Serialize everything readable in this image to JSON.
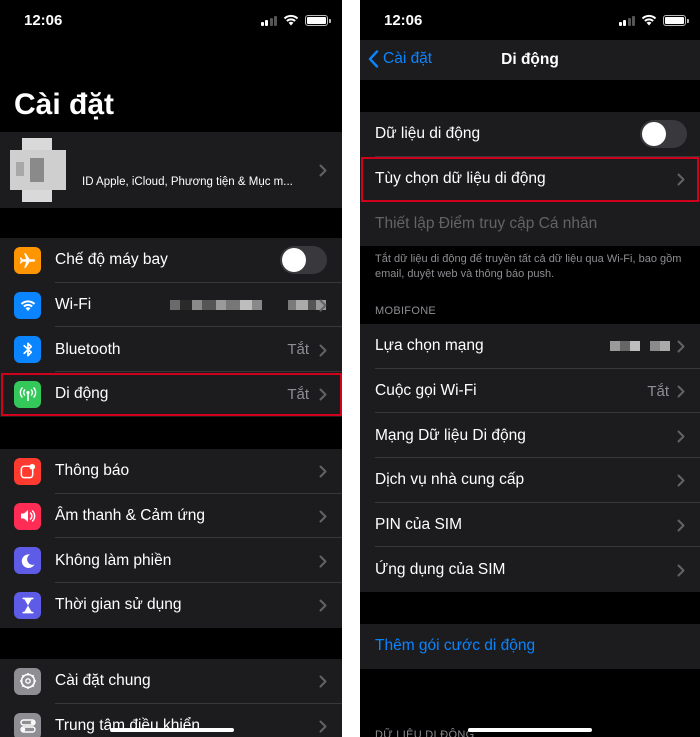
{
  "left": {
    "status_time": "12:06",
    "title": "Cài đặt",
    "profile_subtitle": "ID Apple, iCloud, Phương tiện & Mục m...",
    "group1": [
      {
        "label": "Chế độ máy bay",
        "value": "",
        "icon": "airplane-icon",
        "color": "#ff9500",
        "toggle": true
      },
      {
        "label": "Wi-Fi",
        "value": "",
        "icon": "wifi-icon",
        "color": "#0a84ff",
        "toggle": false
      },
      {
        "label": "Bluetooth",
        "value": "Tắt",
        "icon": "bluetooth-icon",
        "color": "#0a84ff",
        "toggle": false
      },
      {
        "label": "Di động",
        "value": "Tắt",
        "icon": "cellular-antenna-icon",
        "color": "#34c759",
        "toggle": false
      }
    ],
    "group2": [
      {
        "label": "Thông báo",
        "icon": "notifications-icon",
        "color": "#ff3b30"
      },
      {
        "label": "Âm thanh & Cảm ứng",
        "icon": "sound-speaker-icon",
        "color": "#ff2d55"
      },
      {
        "label": "Không làm phiền",
        "icon": "moon-icon",
        "color": "#5e5ce6"
      },
      {
        "label": "Thời gian sử dụng",
        "icon": "hourglass-icon",
        "color": "#5e5ce6"
      }
    ],
    "group3": [
      {
        "label": "Cài đặt chung",
        "icon": "gear-icon",
        "color": "#8e8e93"
      },
      {
        "label": "Trung tâm điều khiển",
        "icon": "control-center-icon",
        "color": "#8e8e93"
      }
    ]
  },
  "right": {
    "status_time": "12:06",
    "back_label": "Cài đặt",
    "nav_title": "Di động",
    "group1": [
      {
        "label": "Dữ liệu di động",
        "toggle": true,
        "dim": false
      },
      {
        "label": "Tùy chọn dữ liệu di động",
        "toggle": false,
        "dim": false
      },
      {
        "label": "Thiết lập Điểm truy cập Cá nhân",
        "toggle": false,
        "dim": true
      }
    ],
    "footnote": "Tắt dữ liệu di động để truyền tất cả dữ liệu qua Wi-Fi, bao gồm email, duyệt web và thông báo push.",
    "section_carrier": "MOBIFONE",
    "group2": [
      {
        "label": "Lựa chọn mạng",
        "value": ""
      },
      {
        "label": "Cuộc gọi Wi-Fi",
        "value": "Tắt"
      },
      {
        "label": "Mạng Dữ liệu Di động",
        "value": ""
      },
      {
        "label": "Dịch vụ nhà cung cấp",
        "value": ""
      },
      {
        "label": "PIN của SIM",
        "value": ""
      },
      {
        "label": "Ứng dụng của SIM",
        "value": ""
      }
    ],
    "add_plan": "Thêm gói cước di động",
    "section_data": "DỮ LIỆU DI ĐỘNG"
  }
}
